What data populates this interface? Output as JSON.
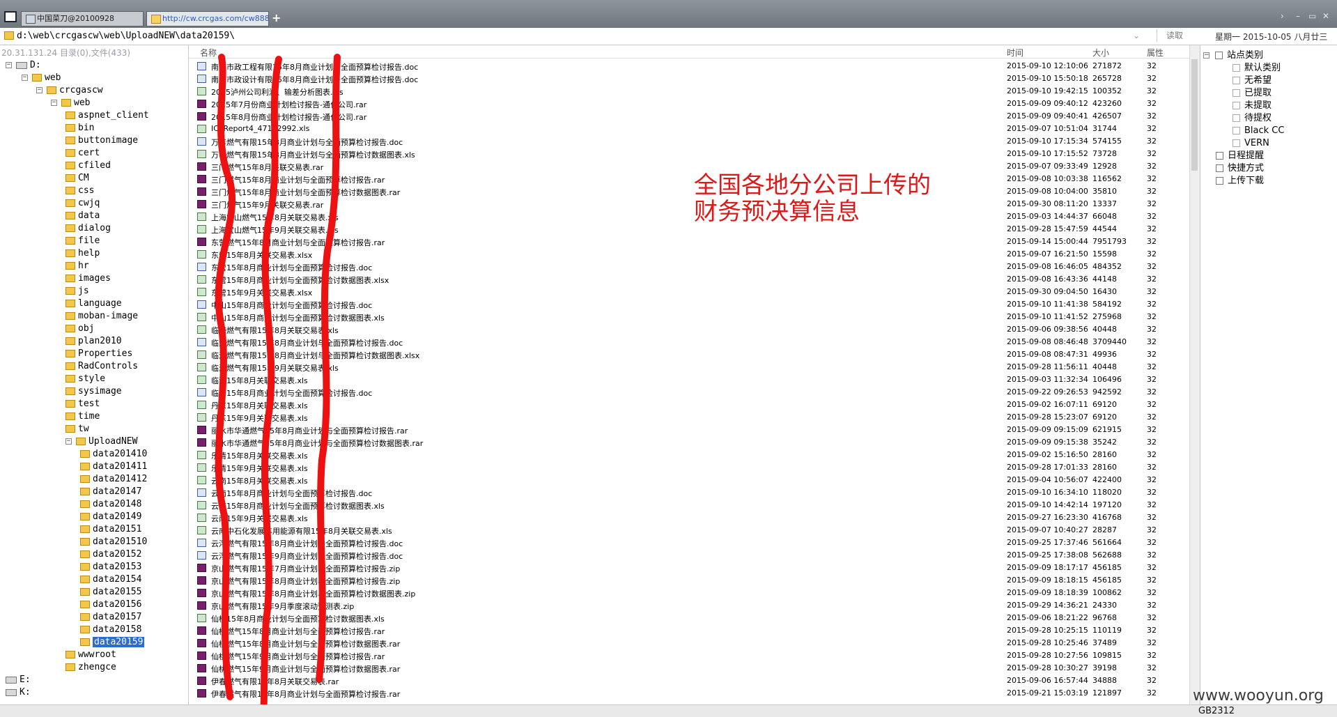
{
  "tabs": [
    {
      "label": "中国菜刀@20100928"
    },
    {
      "label": "http://cw.crcgas.com/cw888..."
    }
  ],
  "tab_add": "+",
  "window_controls": [
    "›",
    "–",
    "▭",
    "✕"
  ],
  "address": {
    "path": "d:\\web\\crcgascw\\web\\UploadNEW\\data20159\\",
    "read_button": "读取",
    "date": "星期一 2015-10-05 八月廿三"
  },
  "left_panel": {
    "info": "20.31.131.24  目录(0),文件(433)",
    "tree": [
      {
        "label": "D:",
        "type": "drive",
        "level": 0,
        "expand": "−"
      },
      {
        "label": "web",
        "type": "folder",
        "level": 1,
        "expand": "−"
      },
      {
        "label": "crcgascw",
        "type": "folder",
        "level": 2,
        "expand": "−"
      },
      {
        "label": "web",
        "type": "folder",
        "level": 3,
        "expand": "−"
      },
      {
        "label": "aspnet_client",
        "type": "folder",
        "level": 4
      },
      {
        "label": "bin",
        "type": "folder",
        "level": 4
      },
      {
        "label": "buttonimage",
        "type": "folder",
        "level": 4
      },
      {
        "label": "cert",
        "type": "folder",
        "level": 4
      },
      {
        "label": "cfiled",
        "type": "folder",
        "level": 4
      },
      {
        "label": "CM",
        "type": "folder",
        "level": 4
      },
      {
        "label": "css",
        "type": "folder",
        "level": 4
      },
      {
        "label": "cwjq",
        "type": "folder",
        "level": 4
      },
      {
        "label": "data",
        "type": "folder",
        "level": 4
      },
      {
        "label": "dialog",
        "type": "folder",
        "level": 4
      },
      {
        "label": "file",
        "type": "folder",
        "level": 4
      },
      {
        "label": "help",
        "type": "folder",
        "level": 4
      },
      {
        "label": "hr",
        "type": "folder",
        "level": 4
      },
      {
        "label": "images",
        "type": "folder",
        "level": 4
      },
      {
        "label": "js",
        "type": "folder",
        "level": 4
      },
      {
        "label": "language",
        "type": "folder",
        "level": 4
      },
      {
        "label": "moban-image",
        "type": "folder",
        "level": 4
      },
      {
        "label": "obj",
        "type": "folder",
        "level": 4
      },
      {
        "label": "plan2010",
        "type": "folder",
        "level": 4
      },
      {
        "label": "Properties",
        "type": "folder",
        "level": 4
      },
      {
        "label": "RadControls",
        "type": "folder",
        "level": 4
      },
      {
        "label": "style",
        "type": "folder",
        "level": 4
      },
      {
        "label": "sysimage",
        "type": "folder",
        "level": 4
      },
      {
        "label": "test",
        "type": "folder",
        "level": 4
      },
      {
        "label": "time",
        "type": "folder",
        "level": 4
      },
      {
        "label": "tw",
        "type": "folder",
        "level": 4
      },
      {
        "label": "UploadNEW",
        "type": "folder",
        "level": 4,
        "expand": "−"
      },
      {
        "label": "data201410",
        "type": "folder",
        "level": 5
      },
      {
        "label": "data201411",
        "type": "folder",
        "level": 5
      },
      {
        "label": "data201412",
        "type": "folder",
        "level": 5
      },
      {
        "label": "data20147",
        "type": "folder",
        "level": 5
      },
      {
        "label": "data20148",
        "type": "folder",
        "level": 5
      },
      {
        "label": "data20149",
        "type": "folder",
        "level": 5
      },
      {
        "label": "data20151",
        "type": "folder",
        "level": 5
      },
      {
        "label": "data201510",
        "type": "folder",
        "level": 5
      },
      {
        "label": "data20152",
        "type": "folder",
        "level": 5
      },
      {
        "label": "data20153",
        "type": "folder",
        "level": 5
      },
      {
        "label": "data20154",
        "type": "folder",
        "level": 5
      },
      {
        "label": "data20155",
        "type": "folder",
        "level": 5
      },
      {
        "label": "data20156",
        "type": "folder",
        "level": 5
      },
      {
        "label": "data20157",
        "type": "folder",
        "level": 5
      },
      {
        "label": "data20158",
        "type": "folder",
        "level": 5
      },
      {
        "label": "data20159",
        "type": "folder",
        "level": 5,
        "selected": true
      },
      {
        "label": "wwwroot",
        "type": "folder",
        "level": 4
      },
      {
        "label": "zhengce",
        "type": "folder",
        "level": 4
      },
      {
        "label": "E:",
        "type": "drive",
        "level": 0
      },
      {
        "label": "K:",
        "type": "drive",
        "level": 0
      }
    ]
  },
  "file_list": {
    "columns": {
      "name": "名称",
      "time": "时间",
      "size": "大小",
      "attr": "属性"
    },
    "rows": [
      {
        "name": "南京市政工程有限15年8月商业计划与全面预算检讨报告.doc",
        "time": "2015-09-10 12:10:06",
        "size": "271872",
        "attr": "32",
        "icon": "doc"
      },
      {
        "name": "南京市政设计有限15年8月商业计划与全面预算检讨报告.doc",
        "time": "2015-09-10 15:50:18",
        "size": "265728",
        "attr": "32",
        "icon": "doc"
      },
      {
        "name": "2015泸州公司利润、输差分析图表.xls",
        "time": "2015-09-10 19:42:15",
        "size": "100352",
        "attr": "32",
        "icon": "xls"
      },
      {
        "name": "2015年7月份商业计划检讨报告-通化公司.rar",
        "time": "2015-09-09 09:40:12",
        "size": "423260",
        "attr": "32",
        "icon": "rar"
      },
      {
        "name": "2015年8月份商业计划检讨报告-通化公司.rar",
        "time": "2015-09-09 09:40:41",
        "size": "426507",
        "attr": "32",
        "icon": "rar"
      },
      {
        "name": "ICPReport4_47182992.xls",
        "time": "2015-09-07 10:51:04",
        "size": "31744",
        "attr": "32",
        "icon": "xls"
      },
      {
        "name": "万年燃气有限15年8月商业计划与全面预算检讨报告.doc",
        "time": "2015-09-10 17:15:34",
        "size": "574155",
        "attr": "32",
        "icon": "doc"
      },
      {
        "name": "万年燃气有限15年8月商业计划与全面预算检讨数据图表.xls",
        "time": "2015-09-10 17:15:52",
        "size": "73728",
        "attr": "32",
        "icon": "xls"
      },
      {
        "name": "三门燃气15年8月关联交易表.rar",
        "time": "2015-09-07 09:33:49",
        "size": "12928",
        "attr": "32",
        "icon": "rar"
      },
      {
        "name": "三门燃气15年8月商业计划与全面预算检讨报告.rar",
        "time": "2015-09-08 10:03:38",
        "size": "116562",
        "attr": "32",
        "icon": "rar"
      },
      {
        "name": "三门燃气15年8月商业计划与全面预算检讨数据图表.rar",
        "time": "2015-09-08 10:04:00",
        "size": "35810",
        "attr": "32",
        "icon": "rar"
      },
      {
        "name": "三门燃气15年9月关联交易表.rar",
        "time": "2015-09-30 08:11:20",
        "size": "13337",
        "attr": "32",
        "icon": "rar"
      },
      {
        "name": "上海宝山燃气15年8月关联交易表.xls",
        "time": "2015-09-03 14:44:37",
        "size": "66048",
        "attr": "32",
        "icon": "xls"
      },
      {
        "name": "上海宝山燃气15年9月关联交易表.xls",
        "time": "2015-09-28 15:47:59",
        "size": "44544",
        "attr": "32",
        "icon": "xls"
      },
      {
        "name": "东营燃气15年8月商业计划与全面预算检讨报告.rar",
        "time": "2015-09-14 15:00:44",
        "size": "7951793",
        "attr": "32",
        "icon": "rar"
      },
      {
        "name": "东营15年8月关联交易表.xlsx",
        "time": "2015-09-07 16:21:50",
        "size": "15598",
        "attr": "32",
        "icon": "xls"
      },
      {
        "name": "东营15年8月商业计划与全面预算检讨报告.doc",
        "time": "2015-09-08 16:46:05",
        "size": "484352",
        "attr": "32",
        "icon": "doc"
      },
      {
        "name": "东营15年8月商业计划与全面预算检讨数据图表.xlsx",
        "time": "2015-09-08 16:43:36",
        "size": "44148",
        "attr": "32",
        "icon": "xls"
      },
      {
        "name": "东营15年9月关联交易表.xlsx",
        "time": "2015-09-30 09:04:50",
        "size": "16430",
        "attr": "32",
        "icon": "xls"
      },
      {
        "name": "中山15年8月商业计划与全面预算检讨报告.doc",
        "time": "2015-09-10 11:41:38",
        "size": "584192",
        "attr": "32",
        "icon": "doc"
      },
      {
        "name": "中山15年8月商业计划与全面预算检讨数据图表.xls",
        "time": "2015-09-10 11:41:52",
        "size": "275968",
        "attr": "32",
        "icon": "xls"
      },
      {
        "name": "临海燃气有限15年8月关联交易表.xls",
        "time": "2015-09-06 09:38:56",
        "size": "40448",
        "attr": "32",
        "icon": "xls"
      },
      {
        "name": "临海燃气有限15年8月商业计划与全面预算检讨报告.doc",
        "time": "2015-09-08 08:46:48",
        "size": "3709440",
        "attr": "32",
        "icon": "doc"
      },
      {
        "name": "临海燃气有限15年8月商业计划与全面预算检讨数据图表.xlsx",
        "time": "2015-09-08 08:47:31",
        "size": "49936",
        "attr": "32",
        "icon": "xls"
      },
      {
        "name": "临海燃气有限15年9月关联交易表.xls",
        "time": "2015-09-28 11:56:11",
        "size": "40448",
        "attr": "32",
        "icon": "xls"
      },
      {
        "name": "临沂15年8月关联交易表.xls",
        "time": "2015-09-03 11:32:34",
        "size": "106496",
        "attr": "32",
        "icon": "xls"
      },
      {
        "name": "临沂15年8月商业计划与全面预算检讨报告.doc",
        "time": "2015-09-22 09:26:53",
        "size": "942592",
        "attr": "32",
        "icon": "doc"
      },
      {
        "name": "丹东15年8月关联交易表.xls",
        "time": "2015-09-02 16:07:11",
        "size": "69120",
        "attr": "32",
        "icon": "xls"
      },
      {
        "name": "丹东15年9月关联交易表.xls",
        "time": "2015-09-28 15:23:07",
        "size": "69120",
        "attr": "32",
        "icon": "xls"
      },
      {
        "name": "丽水市华通燃气15年8月商业计划与全面预算检讨报告.rar",
        "time": "2015-09-09 09:15:09",
        "size": "621915",
        "attr": "32",
        "icon": "rar"
      },
      {
        "name": "丽水市华通燃气15年8月商业计划与全面预算检讨数据图表.rar",
        "time": "2015-09-09 09:15:38",
        "size": "35242",
        "attr": "32",
        "icon": "rar"
      },
      {
        "name": "乐清15年8月关联交易表.xls",
        "time": "2015-09-02 15:16:50",
        "size": "28160",
        "attr": "32",
        "icon": "xls"
      },
      {
        "name": "乐清15年9月关联交易表.xls",
        "time": "2015-09-28 17:01:33",
        "size": "28160",
        "attr": "32",
        "icon": "xls"
      },
      {
        "name": "云南15年8月关联交易表.xls",
        "time": "2015-09-04 10:56:07",
        "size": "422400",
        "attr": "32",
        "icon": "xls"
      },
      {
        "name": "云南15年8月商业计划与全面预算检讨报告.doc",
        "time": "2015-09-10 16:34:10",
        "size": "118020",
        "attr": "32",
        "icon": "doc"
      },
      {
        "name": "云南15年8月商业计划与全面预算检讨数据图表.xls",
        "time": "2015-09-10 14:42:14",
        "size": "197120",
        "attr": "32",
        "icon": "xls"
      },
      {
        "name": "云南15年9月关联交易表.xls",
        "time": "2015-09-27 16:23:30",
        "size": "416768",
        "attr": "32",
        "icon": "xls"
      },
      {
        "name": "云南中石化发展车用能源有限15年8月关联交易表.xls",
        "time": "2015-09-07 10:40:27",
        "size": "28287",
        "attr": "32",
        "icon": "xls"
      },
      {
        "name": "云浮燃气有限15年8月商业计划与全面预算检讨报告.doc",
        "time": "2015-09-25 17:37:46",
        "size": "561664",
        "attr": "32",
        "icon": "doc"
      },
      {
        "name": "云浮燃气有限15年9月商业计划与全面预算检讨报告.doc",
        "time": "2015-09-25 17:38:08",
        "size": "562688",
        "attr": "32",
        "icon": "doc"
      },
      {
        "name": "京山燃气有限15年7月商业计划与全面预算检讨报告.zip",
        "time": "2015-09-09 18:17:17",
        "size": "456185",
        "attr": "32",
        "icon": "rar"
      },
      {
        "name": "京山燃气有限15年8月商业计划与全面预算检讨报告.zip",
        "time": "2015-09-09 18:18:15",
        "size": "456185",
        "attr": "32",
        "icon": "rar"
      },
      {
        "name": "京山燃气有限15年8月商业计划与全面预算检讨数据图表.zip",
        "time": "2015-09-09 18:18:39",
        "size": "100862",
        "attr": "32",
        "icon": "rar"
      },
      {
        "name": "京山燃气有限15年9月季度滚动预测表.zip",
        "time": "2015-09-29 14:36:21",
        "size": "24330",
        "attr": "32",
        "icon": "rar"
      },
      {
        "name": "仙桃15年8月商业计划与全面预算检讨数据图表.xls",
        "time": "2015-09-06 18:21:22",
        "size": "96768",
        "attr": "32",
        "icon": "xls"
      },
      {
        "name": "仙桃燃气15年8月商业计划与全面预算检讨报告.rar",
        "time": "2015-09-28 10:25:15",
        "size": "110119",
        "attr": "32",
        "icon": "rar"
      },
      {
        "name": "仙桃燃气15年8月商业计划与全面预算检讨数据图表.rar",
        "time": "2015-09-28 10:25:46",
        "size": "37489",
        "attr": "32",
        "icon": "rar"
      },
      {
        "name": "仙桃燃气15年9月商业计划与全面预算检讨报告.rar",
        "time": "2015-09-28 10:27:56",
        "size": "109815",
        "attr": "32",
        "icon": "rar"
      },
      {
        "name": "仙桃燃气15年9月商业计划与全面预算检讨数据图表.rar",
        "time": "2015-09-28 10:30:27",
        "size": "39198",
        "attr": "32",
        "icon": "rar"
      },
      {
        "name": "伊春燃气有限15年8月关联交易表.rar",
        "time": "2015-09-06 16:57:44",
        "size": "34888",
        "attr": "32",
        "icon": "rar"
      },
      {
        "name": "伊春燃气有限15年8月商业计划与全面预算检讨报告.rar",
        "time": "2015-09-21 15:03:19",
        "size": "121897",
        "attr": "32",
        "icon": "rar"
      }
    ]
  },
  "right_panel": {
    "items": [
      {
        "label": "站点类别",
        "kind": "root"
      },
      {
        "label": "默认类别",
        "kind": "child"
      },
      {
        "label": "无希望",
        "kind": "child"
      },
      {
        "label": "已提取",
        "kind": "child"
      },
      {
        "label": "未提取",
        "kind": "child"
      },
      {
        "label": "待提权",
        "kind": "child"
      },
      {
        "label": "Black CC",
        "kind": "child"
      },
      {
        "label": "VERN",
        "kind": "child"
      },
      {
        "label": "日程提醒",
        "kind": "root2"
      },
      {
        "label": "快捷方式",
        "kind": "root2"
      },
      {
        "label": "上传下载",
        "kind": "root2"
      }
    ]
  },
  "annotation": {
    "line1": "全国各地分公司上传的",
    "line2": "财务预决算信息",
    "color": "#e01818"
  },
  "status": {
    "encoding": "GB2312"
  },
  "watermark": "www.wooyun.org"
}
